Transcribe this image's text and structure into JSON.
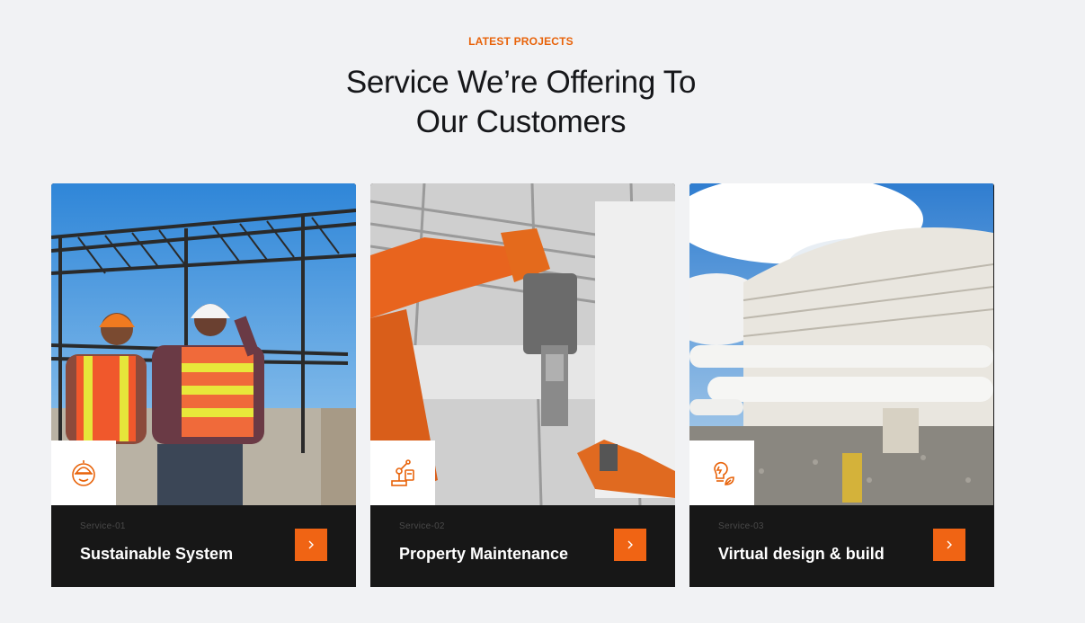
{
  "section": {
    "eyebrow": "LATEST PROJECTS",
    "title_line1": "Service We’re Offering To",
    "title_line2": "Our Customers"
  },
  "colors": {
    "accent": "#f06414",
    "eyebrow": "#e8630a",
    "card_dark": "#171717",
    "page_bg": "#f1f2f4"
  },
  "cards": [
    {
      "number": "Service-01",
      "title": "Sustainable System",
      "icon": "safety-helmet-gear-icon",
      "image": "engineers-steel-frame-photo"
    },
    {
      "number": "Service-02",
      "title": "Property Maintenance",
      "icon": "robot-arm-icon",
      "image": "industrial-robot-arm-photo"
    },
    {
      "number": "Service-03",
      "title": "Virtual design & build",
      "icon": "lightbulb-leaf-icon",
      "image": "storage-tank-pipes-photo"
    }
  ]
}
